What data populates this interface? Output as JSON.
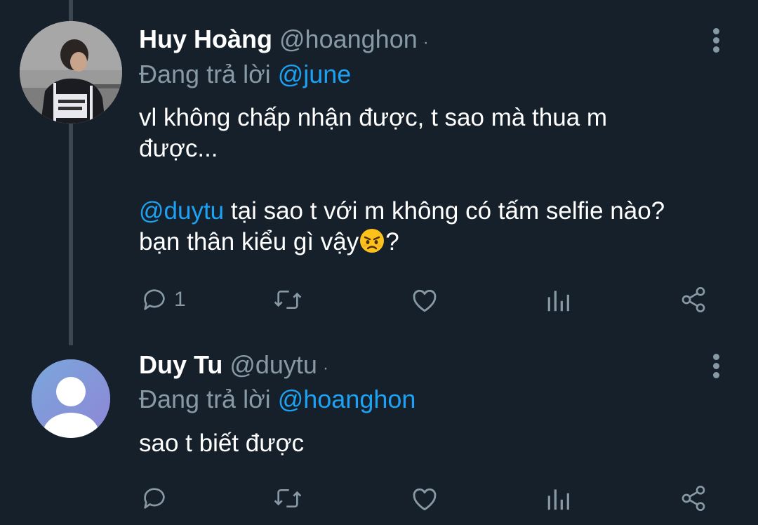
{
  "tweets": [
    {
      "name": "Huy Hoàng",
      "handle": "@hoanghon",
      "separator": "·",
      "replying_prefix": "Đang trả lời",
      "replying_to": "@june",
      "text_line1": "vl không chấp nhận được, t sao mà thua m",
      "text_line1b": "được...",
      "mention": "@duytu",
      "text_line2": " tại sao t với m không có tấm selfie nào?",
      "text_line3": "bạn thân kiểu gì vậy",
      "text_line3_end": "?",
      "emoji": "angry-face-emoji",
      "reply_count": "1",
      "avatar": "photo-avatar"
    },
    {
      "name": "Duy Tu",
      "handle": "@duytu",
      "separator": "·",
      "replying_prefix": "Đang trả lời",
      "replying_to": "@hoanghon",
      "text": "sao t biết được",
      "reply_count": "",
      "avatar": "default-avatar"
    }
  ],
  "icons": {
    "reply": "reply-icon",
    "retweet": "retweet-icon",
    "like": "heart-icon",
    "analytics": "analytics-icon",
    "share": "share-icon",
    "more": "more-vertical-icon"
  },
  "colors": {
    "background": "#15202b",
    "secondary_text": "#8899a6",
    "link": "#1da1f2",
    "thread_line": "#3b4650"
  }
}
